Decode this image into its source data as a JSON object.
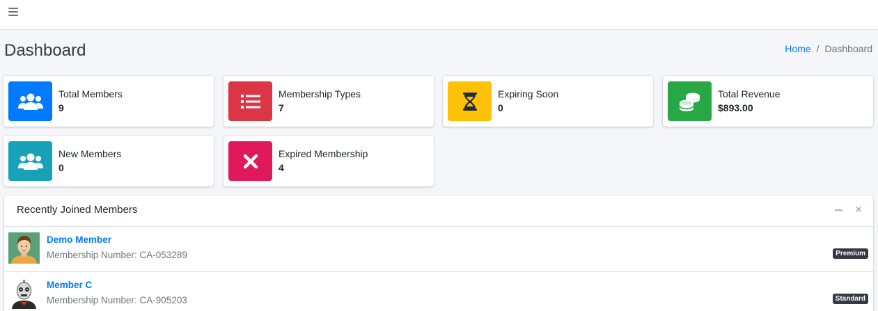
{
  "topbar": {
    "menu_icon": "hamburger-icon"
  },
  "page": {
    "title": "Dashboard"
  },
  "breadcrumb": {
    "home": "Home",
    "separator": "/",
    "current": "Dashboard"
  },
  "info_boxes": [
    {
      "label": "Total Members",
      "value": "9",
      "icon": "users-icon",
      "color": "#007bff"
    },
    {
      "label": "Membership Types",
      "value": "7",
      "icon": "list-icon",
      "color": "#dc3545"
    },
    {
      "label": "Expiring Soon",
      "value": "0",
      "icon": "hourglass-icon",
      "color": "#ffc107"
    },
    {
      "label": "Total Revenue",
      "value": "$893.00",
      "icon": "coins-icon",
      "color": "#28a745"
    },
    {
      "label": "New Members",
      "value": "0",
      "icon": "users-icon",
      "color": "#17a2b8"
    },
    {
      "label": "Expired Membership",
      "value": "4",
      "icon": "times-icon",
      "color": "#e0195a"
    }
  ],
  "recent_members": {
    "title": "Recently Joined Members",
    "minimize_icon": "minus-icon",
    "close_icon": "close-icon",
    "items": [
      {
        "name": "Demo Member",
        "number": "Membership Number: CA-053289",
        "badge": "Premium",
        "avatar": "man-avatar"
      },
      {
        "name": "Member C",
        "number": "Membership Number: CA-905203",
        "badge": "Standard",
        "avatar": "robot-avatar"
      }
    ]
  }
}
